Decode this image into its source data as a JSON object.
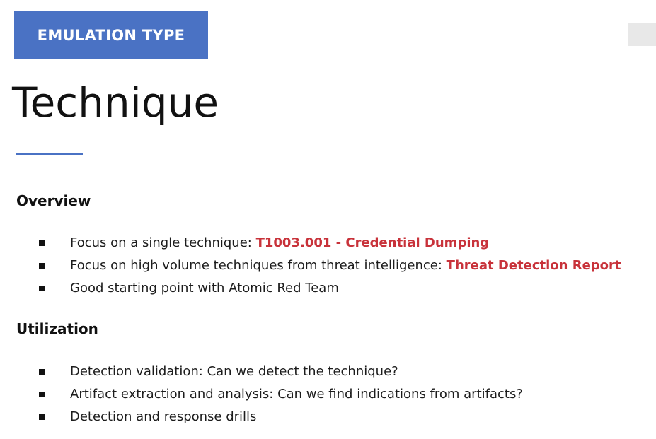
{
  "badge": {
    "label": "EMULATION TYPE"
  },
  "title": "Technique",
  "overview": {
    "heading": "Overview",
    "items": [
      {
        "text": "Focus on a single technique: ",
        "highlight": "T1003.001 - Credential Dumping"
      },
      {
        "text": "Focus on high volume techniques from threat intelligence: ",
        "highlight": "Threat Detection Report"
      },
      {
        "text": "Good starting point with Atomic Red Team",
        "highlight": ""
      }
    ]
  },
  "utilization": {
    "heading": "Utilization",
    "items": [
      {
        "text": "Detection validation: Can we detect the technique?"
      },
      {
        "text": "Artifact extraction and analysis: Can we find indications from artifacts?"
      },
      {
        "text": "Detection and response drills"
      }
    ]
  },
  "colors": {
    "accent": "#4a72c4",
    "highlight": "#c8323a"
  }
}
